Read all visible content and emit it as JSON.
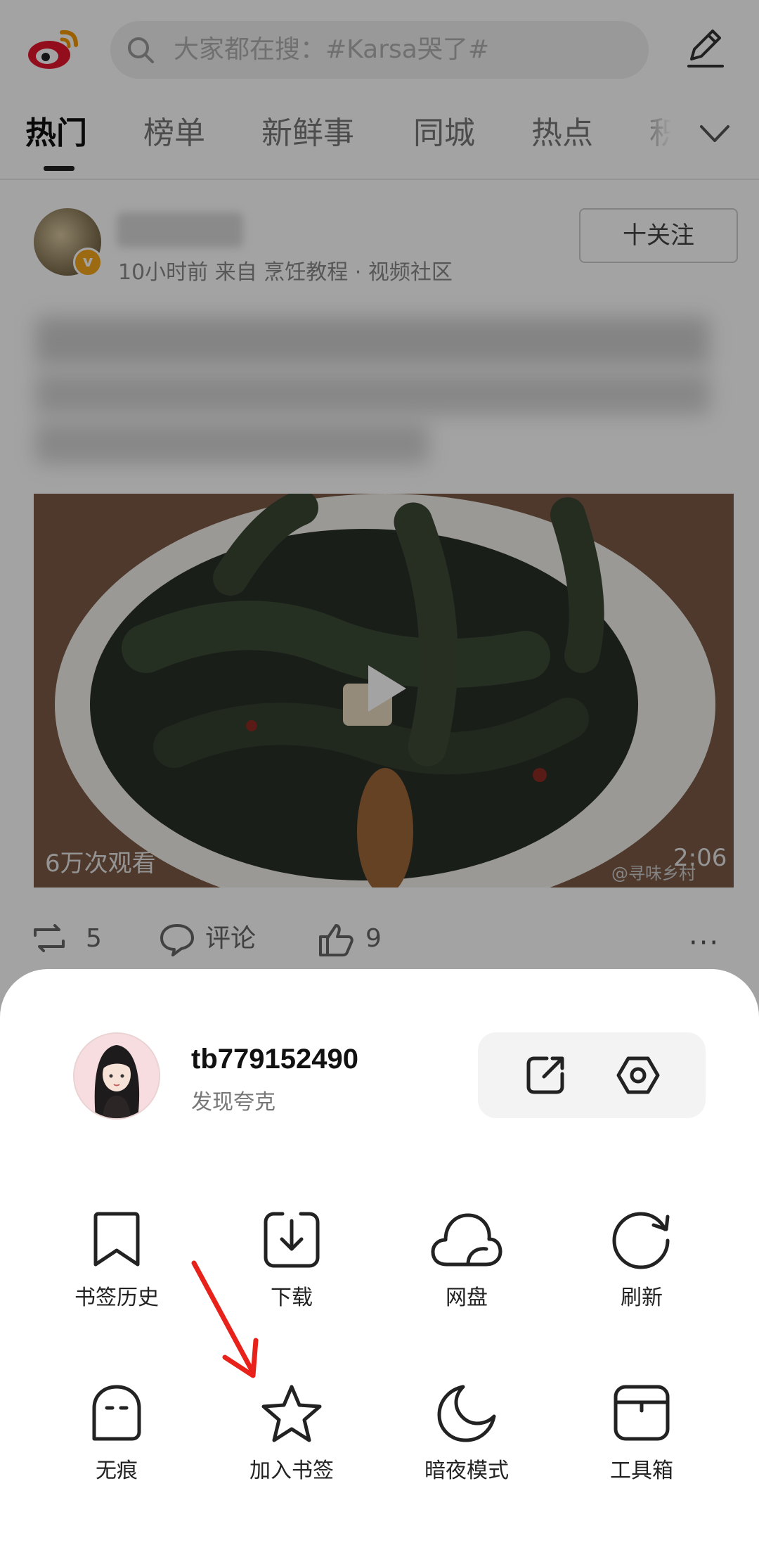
{
  "top_bar": {
    "search_placeholder": "大家都在搜：#Karsa哭了#"
  },
  "tabs": [
    {
      "label": "热门",
      "active": true
    },
    {
      "label": "榜单"
    },
    {
      "label": "新鲜事"
    },
    {
      "label": "同城"
    },
    {
      "label": "热点"
    },
    {
      "label": "积"
    }
  ],
  "post": {
    "meta": "10小时前  来自 烹饪教程 · 视频社区",
    "follow_label": "十关注",
    "video_views": "6万次观看",
    "video_duration": "2:06",
    "watermark": "@寻味乡村",
    "repost_count": "5",
    "comment_label": "评论",
    "like_count": "9"
  },
  "sheet": {
    "username": "tb779152490",
    "subtitle": "发现夸克",
    "menu": [
      {
        "label": "书签历史",
        "icon": "bookmark-icon"
      },
      {
        "label": "下载",
        "icon": "download-icon"
      },
      {
        "label": "网盘",
        "icon": "cloud-icon"
      },
      {
        "label": "刷新",
        "icon": "refresh-icon"
      },
      {
        "label": "无痕",
        "icon": "ghost-icon"
      },
      {
        "label": "加入书签",
        "icon": "star-icon"
      },
      {
        "label": "暗夜模式",
        "icon": "moon-icon"
      },
      {
        "label": "工具箱",
        "icon": "toolbox-icon"
      }
    ]
  },
  "colors": {
    "accent": "#e8392b",
    "weibo_red": "#e6162d",
    "annotation_arrow": "#e8211a"
  }
}
